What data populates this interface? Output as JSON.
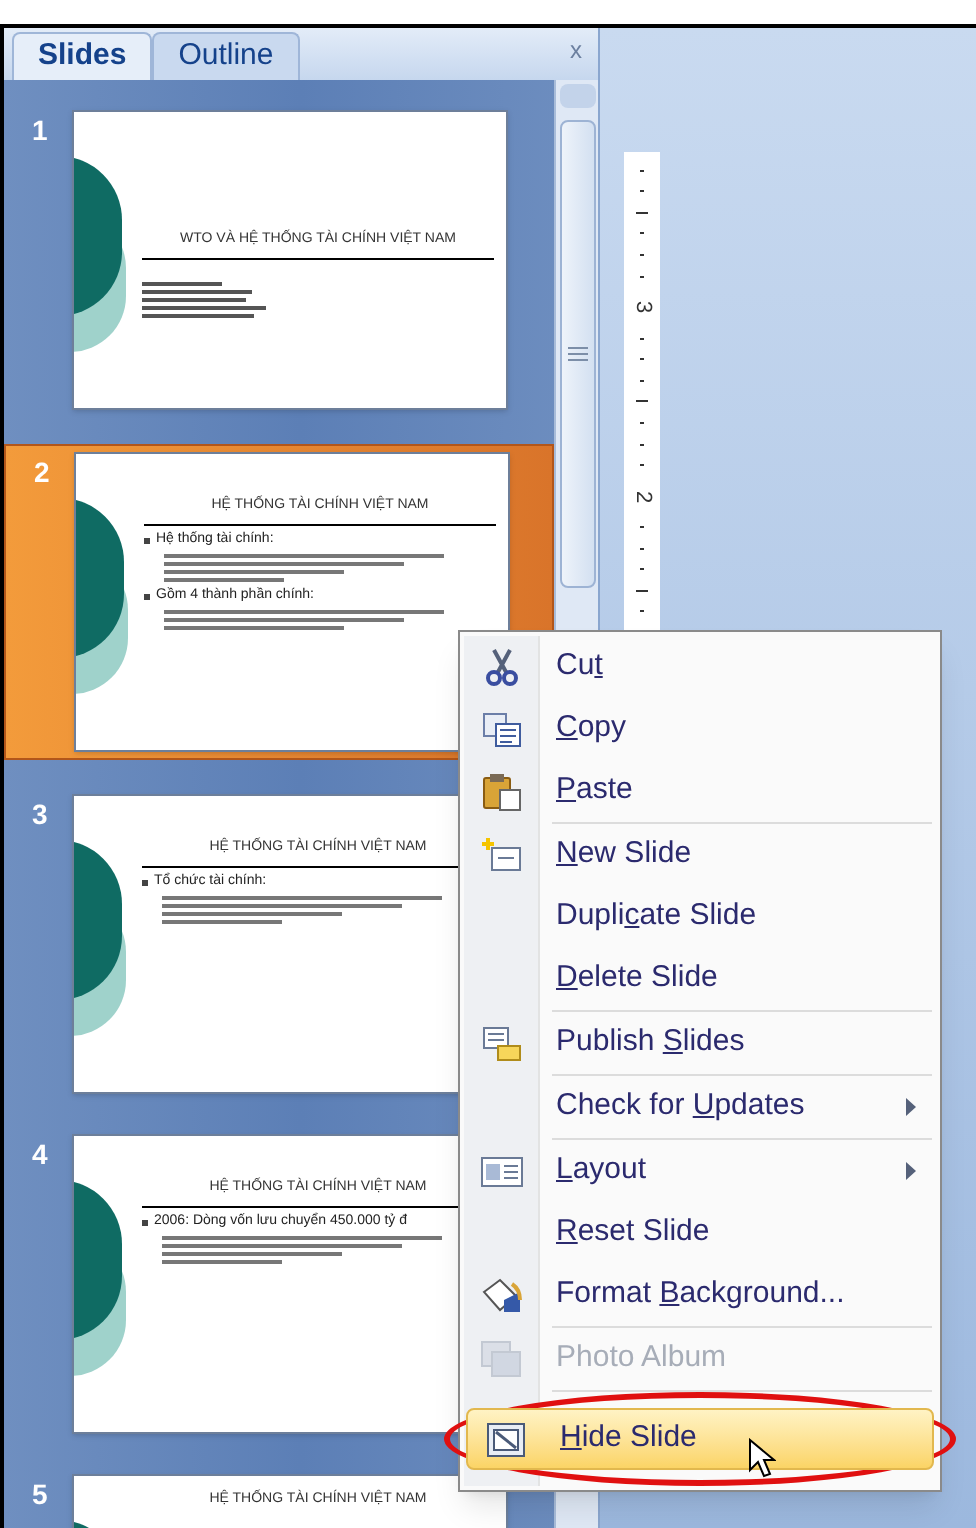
{
  "pane": {
    "tabs": [
      {
        "label": "Slides",
        "selected": true
      },
      {
        "label": "Outline",
        "selected": false
      }
    ],
    "close": "x"
  },
  "slides": [
    {
      "number": "1",
      "selected": false,
      "title": "WTO VÀ HỆ THỐNG TÀI CHÍNH VIỆT NAM",
      "kind": "title"
    },
    {
      "number": "2",
      "selected": true,
      "title": "HỆ THỐNG TÀI CHÍNH VIỆT NAM",
      "kind": "content",
      "bullets": [
        "Hệ thống tài chính:",
        "Gồm 4 thành phần chính:"
      ]
    },
    {
      "number": "3",
      "selected": false,
      "title": "HỆ THỐNG TÀI CHÍNH VIỆT NAM",
      "kind": "content",
      "bullets": [
        "Tổ chức tài chính:"
      ]
    },
    {
      "number": "4",
      "selected": false,
      "title": "HỆ THỐNG TÀI CHÍNH VIỆT NAM",
      "kind": "content",
      "bullets": [
        "2006: Dòng vốn lưu chuyển 450.000 tỷ đ"
      ]
    },
    {
      "number": "5",
      "selected": false,
      "title": "HỆ THỐNG TÀI CHÍNH VIỆT NAM",
      "kind": "partial"
    }
  ],
  "ruler": {
    "labels": [
      "3",
      "2"
    ]
  },
  "context_menu": {
    "items": [
      {
        "before": "Cu",
        "key": "t",
        "kind": "scissors",
        "selected": false,
        "disabled": false
      },
      {
        "key": "C",
        "after": "opy",
        "kind": "copy",
        "selected": false,
        "disabled": false
      },
      {
        "key": "P",
        "after": "aste",
        "kind": "paste",
        "selected": false,
        "disabled": false,
        "separator_after": true
      },
      {
        "key": "N",
        "after": "ew Slide",
        "kind": "newslide",
        "selected": false,
        "disabled": false
      },
      {
        "before": "Dupli",
        "key": "c",
        "after": "ate Slide",
        "selected": false,
        "disabled": false
      },
      {
        "key": "D",
        "after": "elete Slide",
        "selected": false,
        "disabled": false,
        "separator_after": true
      },
      {
        "before": "Publish ",
        "key": "S",
        "after": "lides",
        "kind": "publish",
        "selected": false,
        "disabled": false,
        "separator_after": true
      },
      {
        "before": "Check for ",
        "key": "U",
        "after": "pdates",
        "submenu": true,
        "selected": false,
        "disabled": false,
        "separator_after": true
      },
      {
        "key": "L",
        "after": "ayout",
        "kind": "layout",
        "submenu": true,
        "selected": false,
        "disabled": false
      },
      {
        "key": "R",
        "after": "eset Slide",
        "selected": false,
        "disabled": false
      },
      {
        "before": "Format ",
        "key": "B",
        "after": "ackground...",
        "kind": "format",
        "selected": false,
        "disabled": false,
        "separator_after": true
      },
      {
        "before": "Photo Album",
        "kind": "album",
        "selected": false,
        "disabled": true,
        "separator_after": true
      },
      {
        "key": "H",
        "after": "ide Slide",
        "kind": "hide",
        "selected": true,
        "disabled": false,
        "highlighted_by_circle": true
      }
    ]
  }
}
